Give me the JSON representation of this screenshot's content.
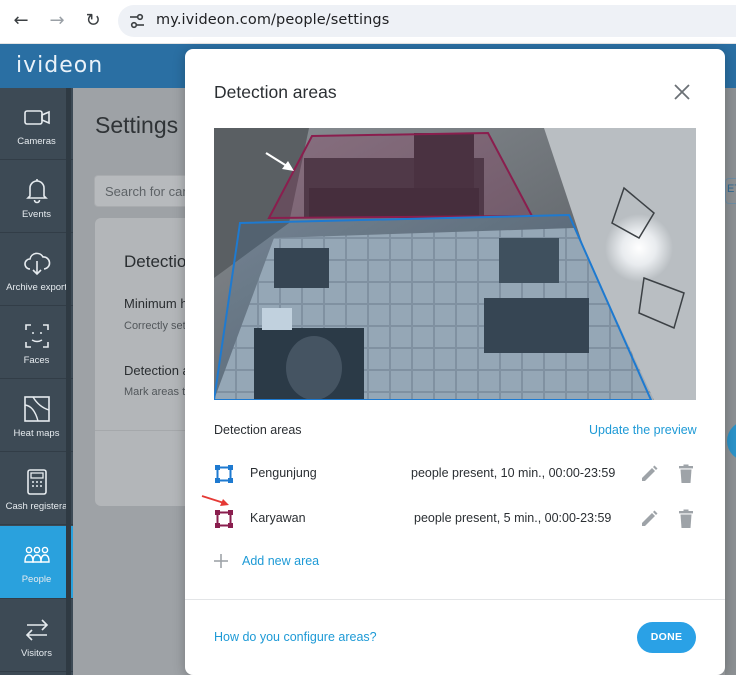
{
  "browser": {
    "url": "my.ivideon.com/people/settings",
    "back_icon": "arrow-left-icon",
    "forward_icon": "arrow-right-icon",
    "reload_icon": "reload-icon"
  },
  "app": {
    "logo": "ivideon",
    "page_title": "Settings",
    "search_placeholder": "Search for cam",
    "bg_card": {
      "title": "Detectio",
      "min_label": "Minimum h",
      "min_desc": "Correctly set",
      "det_label": "Detection a",
      "det_desc": "Mark areas to"
    },
    "right_button_partial": "ET"
  },
  "sidebar": {
    "items": [
      {
        "label": "Cameras",
        "icon": "camera-icon"
      },
      {
        "label": "Events",
        "icon": "bell-icon"
      },
      {
        "label": "Archive export",
        "icon": "cloud-download-icon"
      },
      {
        "label": "Faces",
        "icon": "face-frame-icon"
      },
      {
        "label": "Heat maps",
        "icon": "heat-map-icon"
      },
      {
        "label": "Cash registera",
        "icon": "cash-register-icon"
      },
      {
        "label": "People",
        "icon": "people-icon"
      },
      {
        "label": "Visitors",
        "icon": "visitors-icon"
      }
    ],
    "active": "People"
  },
  "modal": {
    "title": "Detection areas",
    "section_label": "Detection areas",
    "update_preview": "Update the preview",
    "areas": [
      {
        "name": "Pengunjung",
        "description": "people present, 10 min., 00:00-23:59",
        "color": "#1e7ad0"
      },
      {
        "name": "Karyawan",
        "description": "people present, 5 min., 00:00-23:59",
        "color": "#8a1e4e"
      }
    ],
    "add_new_area": "Add new area",
    "help_link": "How do you configure areas?",
    "done_button": "DONE"
  },
  "colors": {
    "accent": "#2aa1e6",
    "header": "#2a6fa3",
    "sidebar": "#3d4a55",
    "area_blue": "#1e7ad0",
    "area_magenta": "#8a1e4e",
    "annotation_arrow_red": "#e53935"
  }
}
